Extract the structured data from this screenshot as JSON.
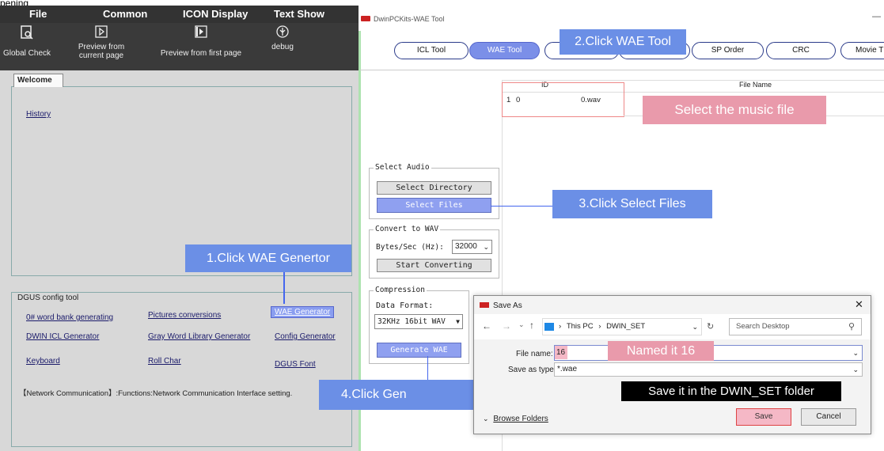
{
  "left": {
    "top_fragment": "pening",
    "menu": [
      "File",
      "Common",
      "ICON Display",
      "Text Show"
    ],
    "toolbar": [
      {
        "label": "Global Check",
        "icon": "global-check-icon"
      },
      {
        "label": "Preview from current page",
        "icon": "preview-current-icon"
      },
      {
        "label": "Preview from first page",
        "icon": "preview-first-icon"
      },
      {
        "label": "debug",
        "icon": "debug-icon"
      }
    ],
    "welcome_tab": "Welcome",
    "history": "History",
    "config_legend": "DGUS config tool",
    "links": {
      "word_bank": "0# word bank generating",
      "pictures": "Pictures conversions",
      "wae": "WAE Generator",
      "icl": "DWIN ICL Generator",
      "gray": "Gray Word Library Generator",
      "config": "Config Generator",
      "keyboard": "Keyboard",
      "roll": "Roll Char",
      "font": "DGUS Font"
    },
    "network_text": "【Network Communication】:Functions:Network Communication Interface setting.",
    "annotation_1": "1.Click WAE Genertor",
    "annotation_4": "4.Click Gen"
  },
  "wae": {
    "title": "DwinPCKits-WAE Tool",
    "minimize": "—",
    "tabs": [
      "ICL Tool",
      "WAE Tool",
      "",
      "",
      "SP Order",
      "CRC",
      "Movie T"
    ],
    "annotation_2": "2.Click WAE Tool",
    "grid": {
      "col_id": "ID",
      "col_file": "File Name",
      "row_num": "1",
      "row_id": "0",
      "row_file": "0.wav"
    },
    "annotation_select": "Select the music file",
    "select_audio": "Select Audio",
    "btn_select_dir": "Select Directory",
    "btn_select_files": "Select Files",
    "annotation_3": "3.Click Select Files",
    "convert_legend": "Convert to WAV",
    "rate_label": "Bytes/Sec (Hz):",
    "rate_value": "32000",
    "btn_convert": "Start Converting",
    "compression_legend": "Compression",
    "data_format_label": "Data Format:",
    "data_format_value": "32KHz 16bit WAV",
    "btn_generate": "Generate WAE"
  },
  "dialog": {
    "title": "Save As",
    "close": "✕",
    "path": [
      "This PC",
      "DWIN_SET"
    ],
    "search_placeholder": "Search Desktop",
    "file_name_label": "File name:",
    "file_name_value": "16",
    "type_label": "Save as type:",
    "type_value": "*.wae",
    "annotation_name": "Named it 16",
    "annotation_folder": "Save it in the DWIN_SET folder",
    "browse": "Browse Folders",
    "save": "Save",
    "cancel": "Cancel"
  }
}
